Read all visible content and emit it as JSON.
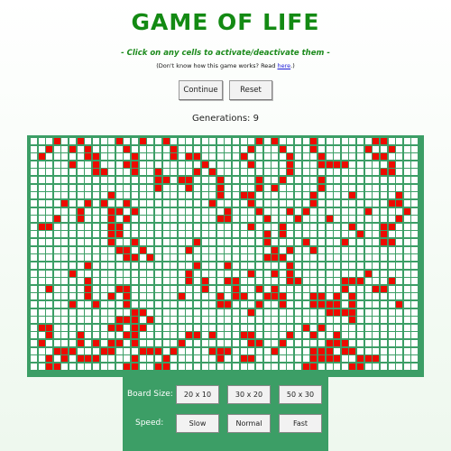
{
  "header": {
    "title": "GAME OF LIFE",
    "instructions": "- Click on any cells to activate/deactivate them -",
    "help_prefix": "(Don't know how this game works? Read ",
    "help_link": "here",
    "help_suffix": ".)"
  },
  "buttons": {
    "continue_label": "Continue",
    "reset_label": "Reset"
  },
  "generations": {
    "label": "Generations:",
    "count": "9"
  },
  "board": {
    "columns": 50,
    "rows": 30,
    "alive_color": "#ee0a00",
    "dead_color": "#ffffff",
    "border_color": "#3c9e66",
    "live_cells": [
      [
        0,
        3
      ],
      [
        0,
        6
      ],
      [
        0,
        11
      ],
      [
        0,
        14
      ],
      [
        0,
        17
      ],
      [
        0,
        29
      ],
      [
        0,
        31
      ],
      [
        0,
        36
      ],
      [
        0,
        44
      ],
      [
        0,
        45
      ],
      [
        1,
        2
      ],
      [
        1,
        5
      ],
      [
        1,
        7
      ],
      [
        1,
        12
      ],
      [
        1,
        18
      ],
      [
        1,
        28
      ],
      [
        1,
        32
      ],
      [
        1,
        36
      ],
      [
        1,
        43
      ],
      [
        1,
        46
      ],
      [
        2,
        1
      ],
      [
        2,
        7
      ],
      [
        2,
        8
      ],
      [
        2,
        13
      ],
      [
        2,
        18
      ],
      [
        2,
        20
      ],
      [
        2,
        21
      ],
      [
        2,
        27
      ],
      [
        2,
        33
      ],
      [
        2,
        37
      ],
      [
        2,
        44
      ],
      [
        2,
        45
      ],
      [
        3,
        5
      ],
      [
        3,
        8
      ],
      [
        3,
        12
      ],
      [
        3,
        13
      ],
      [
        3,
        22
      ],
      [
        3,
        28
      ],
      [
        3,
        33
      ],
      [
        3,
        37
      ],
      [
        3,
        38
      ],
      [
        3,
        39
      ],
      [
        3,
        40
      ],
      [
        3,
        46
      ],
      [
        4,
        8
      ],
      [
        4,
        9
      ],
      [
        4,
        13
      ],
      [
        4,
        16
      ],
      [
        4,
        21
      ],
      [
        4,
        23
      ],
      [
        4,
        33
      ],
      [
        4,
        45
      ],
      [
        4,
        46
      ],
      [
        5,
        16
      ],
      [
        5,
        17
      ],
      [
        5,
        19
      ],
      [
        5,
        20
      ],
      [
        5,
        24
      ],
      [
        5,
        29
      ],
      [
        5,
        32
      ],
      [
        5,
        37
      ],
      [
        6,
        16
      ],
      [
        6,
        20
      ],
      [
        6,
        24
      ],
      [
        6,
        29
      ],
      [
        6,
        31
      ],
      [
        6,
        37
      ],
      [
        7,
        10
      ],
      [
        7,
        24
      ],
      [
        7,
        27
      ],
      [
        7,
        28
      ],
      [
        7,
        36
      ],
      [
        7,
        41
      ],
      [
        7,
        47
      ],
      [
        8,
        4
      ],
      [
        8,
        7
      ],
      [
        8,
        9
      ],
      [
        8,
        12
      ],
      [
        8,
        23
      ],
      [
        8,
        28
      ],
      [
        8,
        36
      ],
      [
        8,
        46
      ],
      [
        8,
        47
      ],
      [
        9,
        6
      ],
      [
        9,
        10
      ],
      [
        9,
        11
      ],
      [
        9,
        13
      ],
      [
        9,
        25
      ],
      [
        9,
        29
      ],
      [
        9,
        33
      ],
      [
        9,
        35
      ],
      [
        9,
        43
      ],
      [
        9,
        48
      ],
      [
        10,
        3
      ],
      [
        10,
        6
      ],
      [
        10,
        10
      ],
      [
        10,
        12
      ],
      [
        10,
        24
      ],
      [
        10,
        25
      ],
      [
        10,
        30
      ],
      [
        10,
        34
      ],
      [
        10,
        38
      ],
      [
        10,
        47
      ],
      [
        11,
        1
      ],
      [
        11,
        2
      ],
      [
        11,
        10
      ],
      [
        11,
        11
      ],
      [
        11,
        28
      ],
      [
        11,
        32
      ],
      [
        11,
        41
      ],
      [
        11,
        45
      ],
      [
        11,
        46
      ],
      [
        12,
        10
      ],
      [
        12,
        11
      ],
      [
        12,
        30
      ],
      [
        12,
        32
      ],
      [
        12,
        42
      ],
      [
        12,
        45
      ],
      [
        13,
        10
      ],
      [
        13,
        13
      ],
      [
        13,
        21
      ],
      [
        13,
        30
      ],
      [
        13,
        35
      ],
      [
        13,
        40
      ],
      [
        13,
        45
      ],
      [
        13,
        46
      ],
      [
        14,
        11
      ],
      [
        14,
        12
      ],
      [
        14,
        14
      ],
      [
        14,
        20
      ],
      [
        14,
        31
      ],
      [
        14,
        33
      ],
      [
        14,
        36
      ],
      [
        15,
        12
      ],
      [
        15,
        13
      ],
      [
        15,
        15
      ],
      [
        15,
        30
      ],
      [
        15,
        31
      ],
      [
        15,
        32
      ],
      [
        16,
        7
      ],
      [
        16,
        21
      ],
      [
        16,
        25
      ],
      [
        16,
        33
      ],
      [
        17,
        5
      ],
      [
        17,
        20
      ],
      [
        17,
        28
      ],
      [
        17,
        31
      ],
      [
        17,
        33
      ],
      [
        17,
        43
      ],
      [
        18,
        7
      ],
      [
        18,
        20
      ],
      [
        18,
        22
      ],
      [
        18,
        25
      ],
      [
        18,
        26
      ],
      [
        18,
        33
      ],
      [
        18,
        34
      ],
      [
        18,
        40
      ],
      [
        18,
        41
      ],
      [
        18,
        42
      ],
      [
        18,
        46
      ],
      [
        19,
        2
      ],
      [
        19,
        7
      ],
      [
        19,
        11
      ],
      [
        19,
        12
      ],
      [
        19,
        22
      ],
      [
        19,
        26
      ],
      [
        19,
        29
      ],
      [
        19,
        31
      ],
      [
        19,
        40
      ],
      [
        19,
        44
      ],
      [
        19,
        45
      ],
      [
        20,
        7
      ],
      [
        20,
        10
      ],
      [
        20,
        12
      ],
      [
        20,
        19
      ],
      [
        20,
        24
      ],
      [
        20,
        26
      ],
      [
        20,
        27
      ],
      [
        20,
        30
      ],
      [
        20,
        31
      ],
      [
        20,
        32
      ],
      [
        20,
        36
      ],
      [
        20,
        37
      ],
      [
        20,
        39
      ],
      [
        20,
        41
      ],
      [
        21,
        5
      ],
      [
        21,
        8
      ],
      [
        21,
        12
      ],
      [
        21,
        24
      ],
      [
        21,
        25
      ],
      [
        21,
        29
      ],
      [
        21,
        32
      ],
      [
        21,
        36
      ],
      [
        21,
        37
      ],
      [
        21,
        38
      ],
      [
        21,
        39
      ],
      [
        21,
        41
      ],
      [
        21,
        47
      ],
      [
        22,
        13
      ],
      [
        22,
        14
      ],
      [
        22,
        28
      ],
      [
        22,
        38
      ],
      [
        22,
        39
      ],
      [
        22,
        40
      ],
      [
        22,
        41
      ],
      [
        23,
        11
      ],
      [
        23,
        12
      ],
      [
        23,
        13
      ],
      [
        23,
        15
      ],
      [
        23,
        41
      ],
      [
        24,
        1
      ],
      [
        24,
        2
      ],
      [
        24,
        10
      ],
      [
        24,
        11
      ],
      [
        24,
        13
      ],
      [
        24,
        14
      ],
      [
        24,
        35
      ],
      [
        24,
        37
      ],
      [
        25,
        2
      ],
      [
        25,
        6
      ],
      [
        25,
        12
      ],
      [
        25,
        13
      ],
      [
        25,
        20
      ],
      [
        25,
        21
      ],
      [
        25,
        23
      ],
      [
        25,
        27
      ],
      [
        25,
        28
      ],
      [
        25,
        33
      ],
      [
        25,
        36
      ],
      [
        25,
        39
      ],
      [
        26,
        1
      ],
      [
        26,
        6
      ],
      [
        26,
        8
      ],
      [
        26,
        10
      ],
      [
        26,
        11
      ],
      [
        26,
        13
      ],
      [
        26,
        19
      ],
      [
        26,
        28
      ],
      [
        26,
        29
      ],
      [
        26,
        32
      ],
      [
        26,
        38
      ],
      [
        26,
        39
      ],
      [
        26,
        40
      ],
      [
        27,
        3
      ],
      [
        27,
        4
      ],
      [
        27,
        5
      ],
      [
        27,
        9
      ],
      [
        27,
        10
      ],
      [
        27,
        14
      ],
      [
        27,
        15
      ],
      [
        27,
        16
      ],
      [
        27,
        18
      ],
      [
        27,
        23
      ],
      [
        27,
        24
      ],
      [
        27,
        25
      ],
      [
        27,
        31
      ],
      [
        27,
        36
      ],
      [
        27,
        37
      ],
      [
        27,
        38
      ],
      [
        27,
        40
      ],
      [
        27,
        41
      ],
      [
        28,
        2
      ],
      [
        28,
        4
      ],
      [
        28,
        6
      ],
      [
        28,
        7
      ],
      [
        28,
        8
      ],
      [
        28,
        13
      ],
      [
        28,
        17
      ],
      [
        28,
        24
      ],
      [
        28,
        27
      ],
      [
        28,
        28
      ],
      [
        28,
        36
      ],
      [
        28,
        37
      ],
      [
        28,
        38
      ],
      [
        28,
        39
      ],
      [
        28,
        42
      ],
      [
        28,
        43
      ],
      [
        28,
        44
      ],
      [
        29,
        2
      ],
      [
        29,
        3
      ],
      [
        29,
        12
      ],
      [
        29,
        13
      ],
      [
        29,
        16
      ],
      [
        29,
        17
      ],
      [
        29,
        35
      ],
      [
        29,
        36
      ],
      [
        29,
        41
      ],
      [
        29,
        42
      ]
    ]
  },
  "controls": {
    "board_size_label": "Board Size:",
    "size_options": [
      "20 x 10",
      "30 x 20",
      "50 x 30"
    ],
    "speed_label": "Speed:",
    "speed_options": [
      "Slow",
      "Normal",
      "Fast"
    ],
    "background_color": "#3c9e66"
  }
}
